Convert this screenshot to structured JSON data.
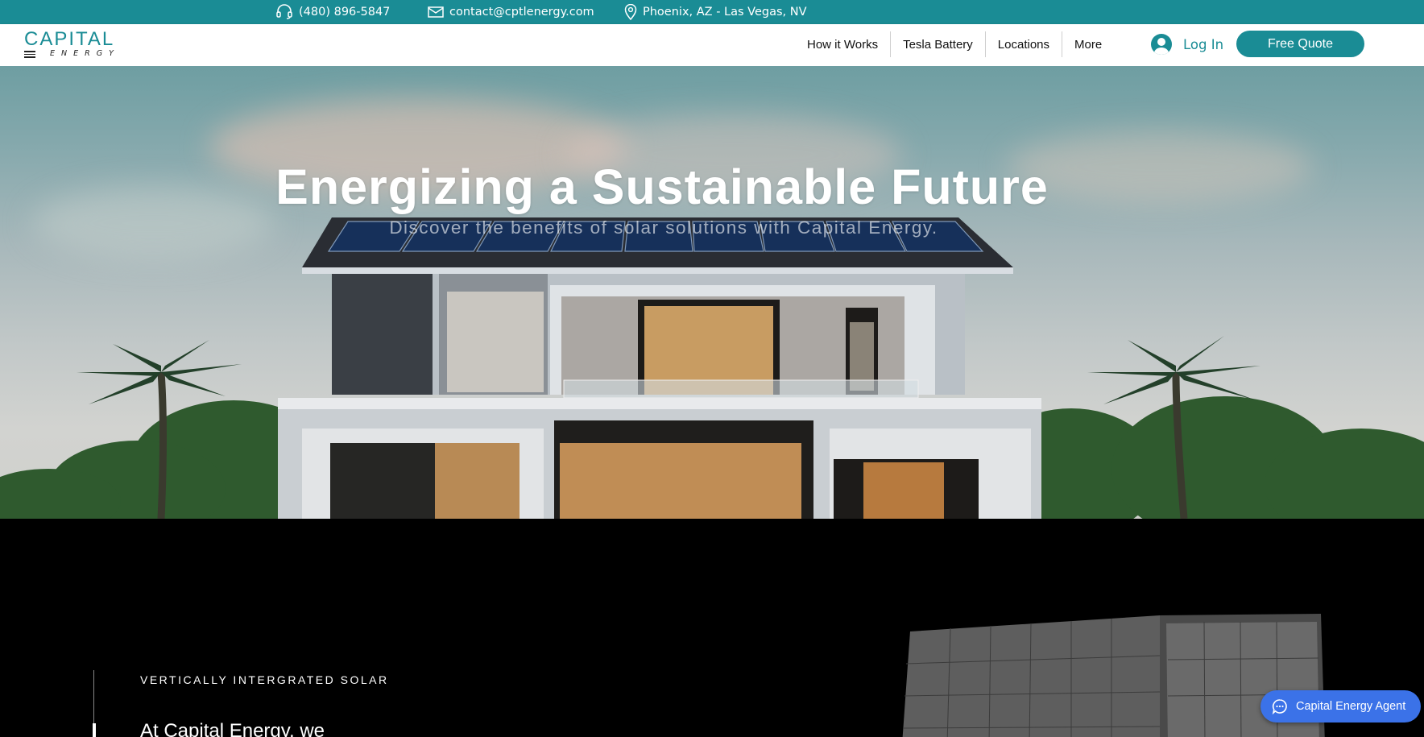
{
  "topbar": {
    "phone": "(480) 896-5847",
    "email": "contact@cptlenergy.com",
    "location": "Phoenix, AZ - Las Vegas, NV"
  },
  "logo": {
    "line1": "CAPITAL",
    "line2": "ENERGY"
  },
  "nav": {
    "items": [
      "How it Works",
      "Tesla Battery",
      "Locations",
      "More"
    ]
  },
  "auth": {
    "login_label": "Log In"
  },
  "cta": {
    "quote_label": "Free Quote"
  },
  "hero": {
    "title": "Energizing a Sustainable Future",
    "subtitle": "Discover the benefits of solar solutions with Capital Energy."
  },
  "about": {
    "eyebrow": "VERTICALLY INTERGRATED SOLAR",
    "lead": "At Capital Energy, we"
  },
  "chat": {
    "label": "Capital Energy Agent"
  },
  "colors": {
    "brand": "#1a8c95",
    "chat": "#3b72e8"
  }
}
